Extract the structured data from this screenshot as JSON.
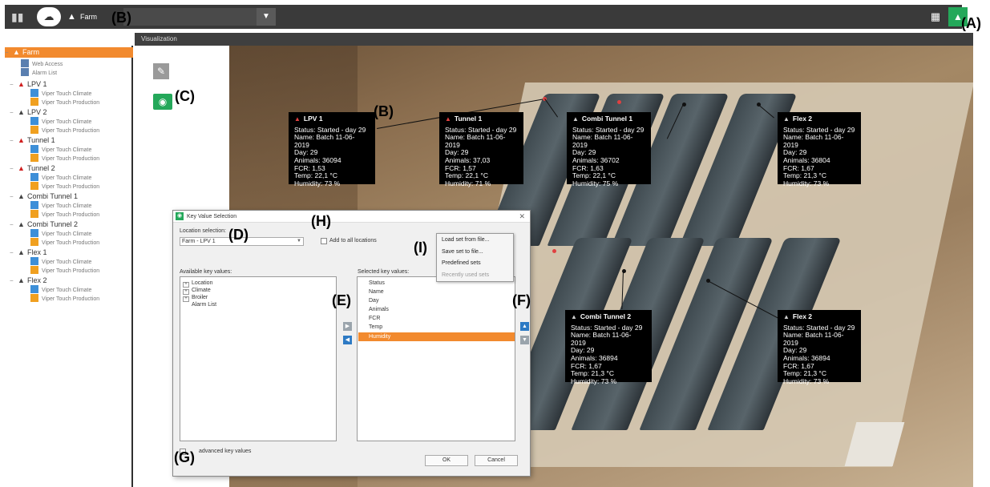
{
  "topbar": {
    "breadcrumb": "Farm",
    "location_select_value": ""
  },
  "subbar": {
    "title": "Visualization"
  },
  "sidebar": {
    "root": "Farm",
    "root_items": [
      "Web Access",
      "Alarm List"
    ],
    "houses": [
      {
        "name": "LPV 1",
        "alarm": true,
        "items": [
          "Viper Touch Climate",
          "Viper Touch Production"
        ]
      },
      {
        "name": "LPV 2",
        "alarm": false,
        "items": [
          "Viper Touch Climate",
          "Viper Touch Production"
        ]
      },
      {
        "name": "Tunnel 1",
        "alarm": true,
        "items": [
          "Viper Touch Climate",
          "Viper Touch Production"
        ]
      },
      {
        "name": "Tunnel 2",
        "alarm": true,
        "items": [
          "Viper Touch Climate",
          "Viper Touch Production"
        ]
      },
      {
        "name": "Combi Tunnel 1",
        "alarm": false,
        "items": [
          "Viper Touch Climate",
          "Viper Touch Production"
        ]
      },
      {
        "name": "Combi Tunnel 2",
        "alarm": false,
        "items": [
          "Viper Touch Climate",
          "Viper Touch Production"
        ]
      },
      {
        "name": "Flex 1",
        "alarm": false,
        "items": [
          "Viper Touch Climate",
          "Viper Touch Production"
        ]
      },
      {
        "name": "Flex 2",
        "alarm": false,
        "items": [
          "Viper Touch Climate",
          "Viper Touch Production"
        ]
      }
    ]
  },
  "callouts": [
    {
      "title": "LPV 1",
      "alarm": true,
      "lines": [
        "Status: Started - day 29",
        "Name: Batch 11-06-2019",
        "Day: 29",
        "Animals: 36094",
        "FCR: 1,53",
        "Temp: 22,1 °C",
        "Humidity: 73 %"
      ]
    },
    {
      "title": "Tunnel 1",
      "alarm": true,
      "lines": [
        "Status: Started - day 29",
        "Name: Batch 11-06-2019",
        "Day: 29",
        "Animals: 37,03",
        "FCR: 1,57",
        "Temp: 22,1 °C",
        "Humidity: 71 %"
      ]
    },
    {
      "title": "Combi Tunnel 1",
      "alarm": false,
      "lines": [
        "Status: Started - day 29",
        "Name: Batch 11-06-2019",
        "Day: 29",
        "Animals: 36702",
        "FCR: 1,63",
        "Temp: 22,1 °C",
        "Humidity: 75 %"
      ]
    },
    {
      "title": "Flex 2",
      "alarm": false,
      "lines": [
        "Status: Started - day 29",
        "Name: Batch 11-06-2019",
        "Day: 29",
        "Animals: 36804",
        "FCR: 1,67",
        "Temp: 21,3 °C",
        "Humidity: 73 %"
      ]
    },
    {
      "title": "Combi Tunnel 2",
      "alarm": false,
      "lines": [
        "Status: Started - day 29",
        "Name: Batch 11-06-2019",
        "Day: 29",
        "Animals: 36894",
        "FCR: 1,67",
        "Temp: 21,3 °C",
        "Humidity: 73 %"
      ]
    },
    {
      "title": "Flex 2",
      "alarm": false,
      "lines": [
        "Status: Started - day 29",
        "Name: Batch 11-06-2019",
        "Day: 29",
        "Animals: 36894",
        "FCR: 1,67",
        "Temp: 21,3 °C",
        "Humidity: 73 %"
      ]
    }
  ],
  "dialog": {
    "title": "Key Value Selection",
    "location_label": "Location selection:",
    "location_value": "Farm - LPV 1",
    "add_all_label": "Add to all locations",
    "available_label": "Available key values:",
    "available": [
      "Location",
      "Climate",
      "Broiler",
      "Alarm List"
    ],
    "selected_label": "Selected key values:",
    "selected": [
      "Status",
      "Name",
      "Day",
      "Animals",
      "FCR",
      "Temp",
      "Humidity"
    ],
    "selected_highlight": "Humidity",
    "advanced_label": "advanced key values",
    "ok": "OK",
    "cancel": "Cancel",
    "menu": [
      "Load set from file...",
      "Save set to file...",
      "Predefined sets",
      "Recently used sets"
    ]
  },
  "annotations": {
    "A": "(A)",
    "B1": "(B)",
    "B2": "(B)",
    "C": "(C)",
    "D": "(D)",
    "E": "(E)",
    "F": "(F)",
    "G": "(G)",
    "H": "(H)",
    "I": "(I)"
  },
  "colors": {
    "accent": "#f28a2e",
    "green": "#24a85a",
    "topbar": "#3a3a3a"
  }
}
